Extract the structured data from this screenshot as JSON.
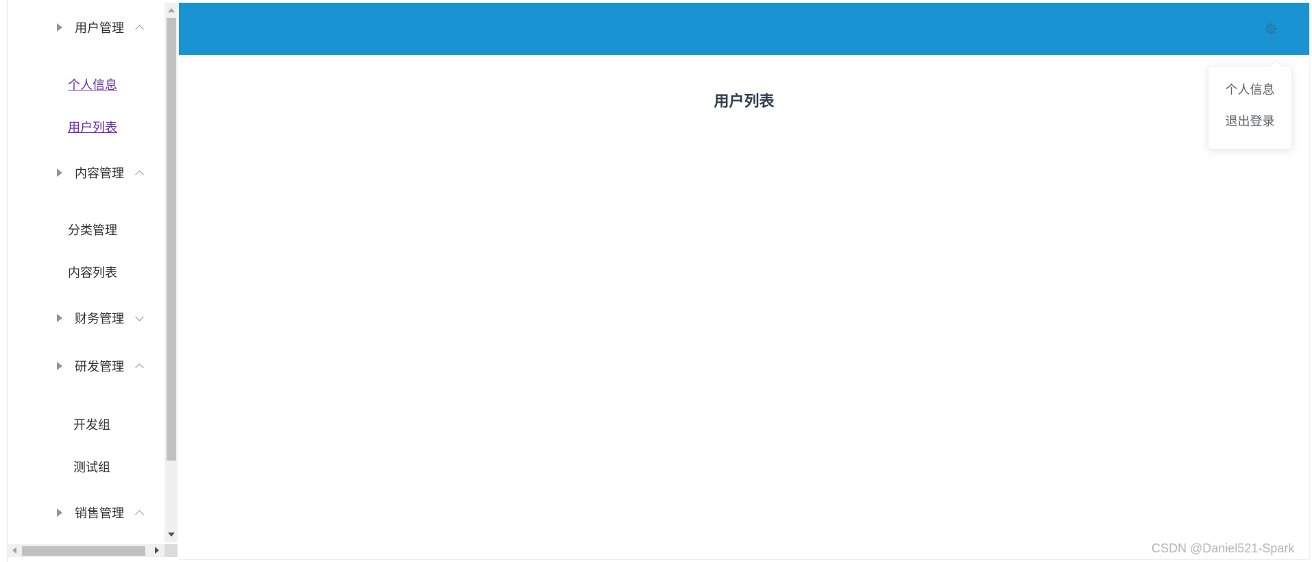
{
  "sidebar": {
    "groups": [
      {
        "label": "用户管理",
        "expanded": true
      },
      {
        "label": "内容管理",
        "expanded": true
      },
      {
        "label": "财务管理",
        "expanded": false
      },
      {
        "label": "研发管理",
        "expanded": true
      },
      {
        "label": "销售管理",
        "expanded": true
      }
    ],
    "items": {
      "user_info": "个人信息",
      "user_list": "用户列表",
      "category_mgmt": "分类管理",
      "content_list": "内容列表",
      "dev_group": "开发组",
      "test_group": "测试组"
    }
  },
  "header": {
    "background_color": "#1a93d2",
    "settings_icon": "gear-icon"
  },
  "main": {
    "page_title": "用户列表"
  },
  "dropdown": {
    "items": [
      "个人信息",
      "退出登录"
    ]
  },
  "watermark": "CSDN @Daniel521-Spark"
}
